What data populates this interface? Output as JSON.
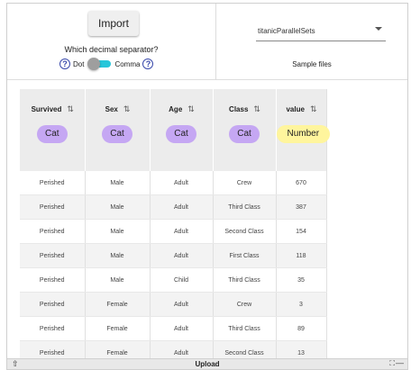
{
  "import_panel": {
    "import_label": "Import",
    "question": "Which decimal separator?",
    "dot_label": "Dot",
    "comma_label": "Comma",
    "help_glyph": "?",
    "help_icon": "help-circle-icon",
    "toggle_state": "comma"
  },
  "sample_panel": {
    "selected": "titanicParallelSets",
    "helper": "Sample files"
  },
  "table": {
    "columns": [
      {
        "name": "Survived",
        "type": "Cat",
        "sort_glyph": "⇅"
      },
      {
        "name": "Sex",
        "type": "Cat",
        "sort_glyph": "⇅"
      },
      {
        "name": "Age",
        "type": "Cat",
        "sort_glyph": "⇅"
      },
      {
        "name": "Class",
        "type": "Cat",
        "sort_glyph": "⇅"
      },
      {
        "name": "value",
        "type": "Number",
        "sort_glyph": "⇅"
      }
    ],
    "rows": [
      [
        "Perished",
        "Male",
        "Adult",
        "Crew",
        "670"
      ],
      [
        "Perished",
        "Male",
        "Adult",
        "Third Class",
        "387"
      ],
      [
        "Perished",
        "Male",
        "Adult",
        "Second Class",
        "154"
      ],
      [
        "Perished",
        "Male",
        "Adult",
        "First Class",
        "118"
      ],
      [
        "Perished",
        "Male",
        "Child",
        "Third Class",
        "35"
      ],
      [
        "Perished",
        "Female",
        "Adult",
        "Crew",
        "3"
      ],
      [
        "Perished",
        "Female",
        "Adult",
        "Third Class",
        "89"
      ],
      [
        "Perished",
        "Female",
        "Adult",
        "Second Class",
        "13"
      ]
    ]
  },
  "colors": {
    "cat_chip": "#c5a7f3",
    "number_chip": "#fff59d",
    "toggle_track": "#26c6da",
    "help_icon": "#3949ab"
  },
  "bottom_bar": {
    "upload_label": "Upload",
    "upload_icon_glyph": "⇧",
    "fullscreen_glyph": "⛶",
    "minimize_glyph": "—"
  }
}
